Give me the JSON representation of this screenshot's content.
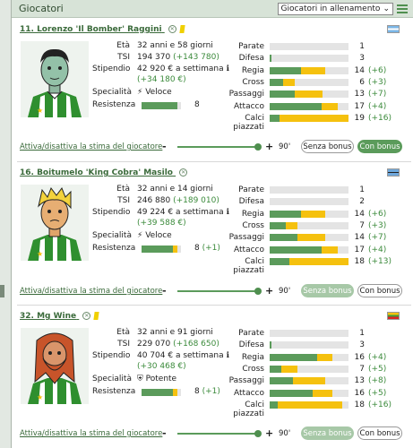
{
  "header": {
    "title": "Giocatori",
    "filter_value": "Giocatori in allenamento"
  },
  "labels": {
    "age": "Età",
    "tsi": "TSI",
    "wage": "Stipendio",
    "specialty": "Specialità",
    "stamina": "Resistenza"
  },
  "players": [
    {
      "name": "11. Lorenzo 'Il Bomber' Raggini",
      "yellow_card": true,
      "flag": "blue-white-stripes",
      "age": "32 anni e 58 giorni",
      "tsi": "194 370",
      "tsi_delta": "(+143 780)",
      "wage": "42 920 € a settimana",
      "wage_delta": "(+34 180 €)",
      "specialty": "Veloce",
      "specialty_icon": "running-icon",
      "stamina_value": "8",
      "stamina_bonus": "",
      "stamina_fraction": 0.9,
      "skills": [
        {
          "label": "Parate",
          "value": "1",
          "bonus": "",
          "green": 0.0,
          "yellow": 0.0
        },
        {
          "label": "Difesa",
          "value": "3",
          "bonus": "",
          "green": 0.02,
          "yellow": 0.0
        },
        {
          "label": "Regia",
          "value": "14",
          "bonus": "(+6)",
          "green": 0.4,
          "yellow": 0.3
        },
        {
          "label": "Cross",
          "value": "6",
          "bonus": "(+3)",
          "green": 0.17,
          "yellow": 0.15
        },
        {
          "label": "Passaggi",
          "value": "13",
          "bonus": "(+7)",
          "green": 0.32,
          "yellow": 0.35
        },
        {
          "label": "Attacco",
          "value": "17",
          "bonus": "(+4)",
          "green": 0.66,
          "yellow": 0.2
        },
        {
          "label": "Calci piazzati",
          "value": "19",
          "bonus": "(+16)",
          "green": 0.13,
          "yellow": 0.87
        }
      ],
      "estimate_link": "Attiva/disattiva la stima del giocatore",
      "slider_value": "90'",
      "btn_no_bonus": "Senza bonus",
      "btn_with_bonus": "Con bonus",
      "active_button": "with"
    },
    {
      "name": "16. Boitumelo 'King Cobra' Masilo",
      "yellow_card": false,
      "flag": "botswana",
      "age": "32 anni e 14 giorni",
      "tsi": "246 880",
      "tsi_delta": "(+189 010)",
      "wage": "49 224 € a settimana",
      "wage_delta": "(+39 588 €)",
      "specialty": "Veloce",
      "specialty_icon": "running-icon",
      "stamina_value": "8",
      "stamina_bonus": "(+1)",
      "stamina_fraction": 0.9,
      "skills": [
        {
          "label": "Parate",
          "value": "1",
          "bonus": "",
          "green": 0.0,
          "yellow": 0.0
        },
        {
          "label": "Difesa",
          "value": "2",
          "bonus": "",
          "green": 0.0,
          "yellow": 0.0
        },
        {
          "label": "Regia",
          "value": "14",
          "bonus": "(+6)",
          "green": 0.4,
          "yellow": 0.3
        },
        {
          "label": "Cross",
          "value": "7",
          "bonus": "(+3)",
          "green": 0.2,
          "yellow": 0.15
        },
        {
          "label": "Passaggi",
          "value": "14",
          "bonus": "(+7)",
          "green": 0.35,
          "yellow": 0.35
        },
        {
          "label": "Attacco",
          "value": "17",
          "bonus": "(+4)",
          "green": 0.66,
          "yellow": 0.2
        },
        {
          "label": "Calci piazzati",
          "value": "18",
          "bonus": "(+13)",
          "green": 0.25,
          "yellow": 0.75
        }
      ],
      "estimate_link": "Attiva/disattiva la stima del giocatore",
      "slider_value": "90'",
      "btn_no_bonus": "Senza bonus",
      "btn_with_bonus": "Con bonus",
      "active_button": "without"
    },
    {
      "name": "32. Mg Wine",
      "yellow_card": true,
      "flag": "myanmar",
      "age": "32 anni e 91 giorni",
      "tsi": "229 070",
      "tsi_delta": "(+168 650)",
      "wage": "40 704 € a settimana",
      "wage_delta": "(+30 468 €)",
      "specialty": "Potente",
      "specialty_icon": "shield-icon",
      "stamina_value": "8",
      "stamina_bonus": "(+1)",
      "stamina_fraction": 0.9,
      "skills": [
        {
          "label": "Parate",
          "value": "1",
          "bonus": "",
          "green": 0.0,
          "yellow": 0.0
        },
        {
          "label": "Difesa",
          "value": "3",
          "bonus": "",
          "green": 0.02,
          "yellow": 0.0
        },
        {
          "label": "Regia",
          "value": "16",
          "bonus": "(+4)",
          "green": 0.6,
          "yellow": 0.2
        },
        {
          "label": "Cross",
          "value": "7",
          "bonus": "(+5)",
          "green": 0.15,
          "yellow": 0.2
        },
        {
          "label": "Passaggi",
          "value": "13",
          "bonus": "(+8)",
          "green": 0.3,
          "yellow": 0.4
        },
        {
          "label": "Attacco",
          "value": "16",
          "bonus": "(+5)",
          "green": 0.55,
          "yellow": 0.25
        },
        {
          "label": "Calci piazzati",
          "value": "18",
          "bonus": "(+16)",
          "green": 0.1,
          "yellow": 0.82
        }
      ],
      "estimate_link": "Attiva/disattiva la stima del giocatore",
      "slider_value": "90'",
      "btn_no_bonus": "Senza bonus",
      "btn_with_bonus": "Con bonus",
      "active_button": "without"
    }
  ]
}
